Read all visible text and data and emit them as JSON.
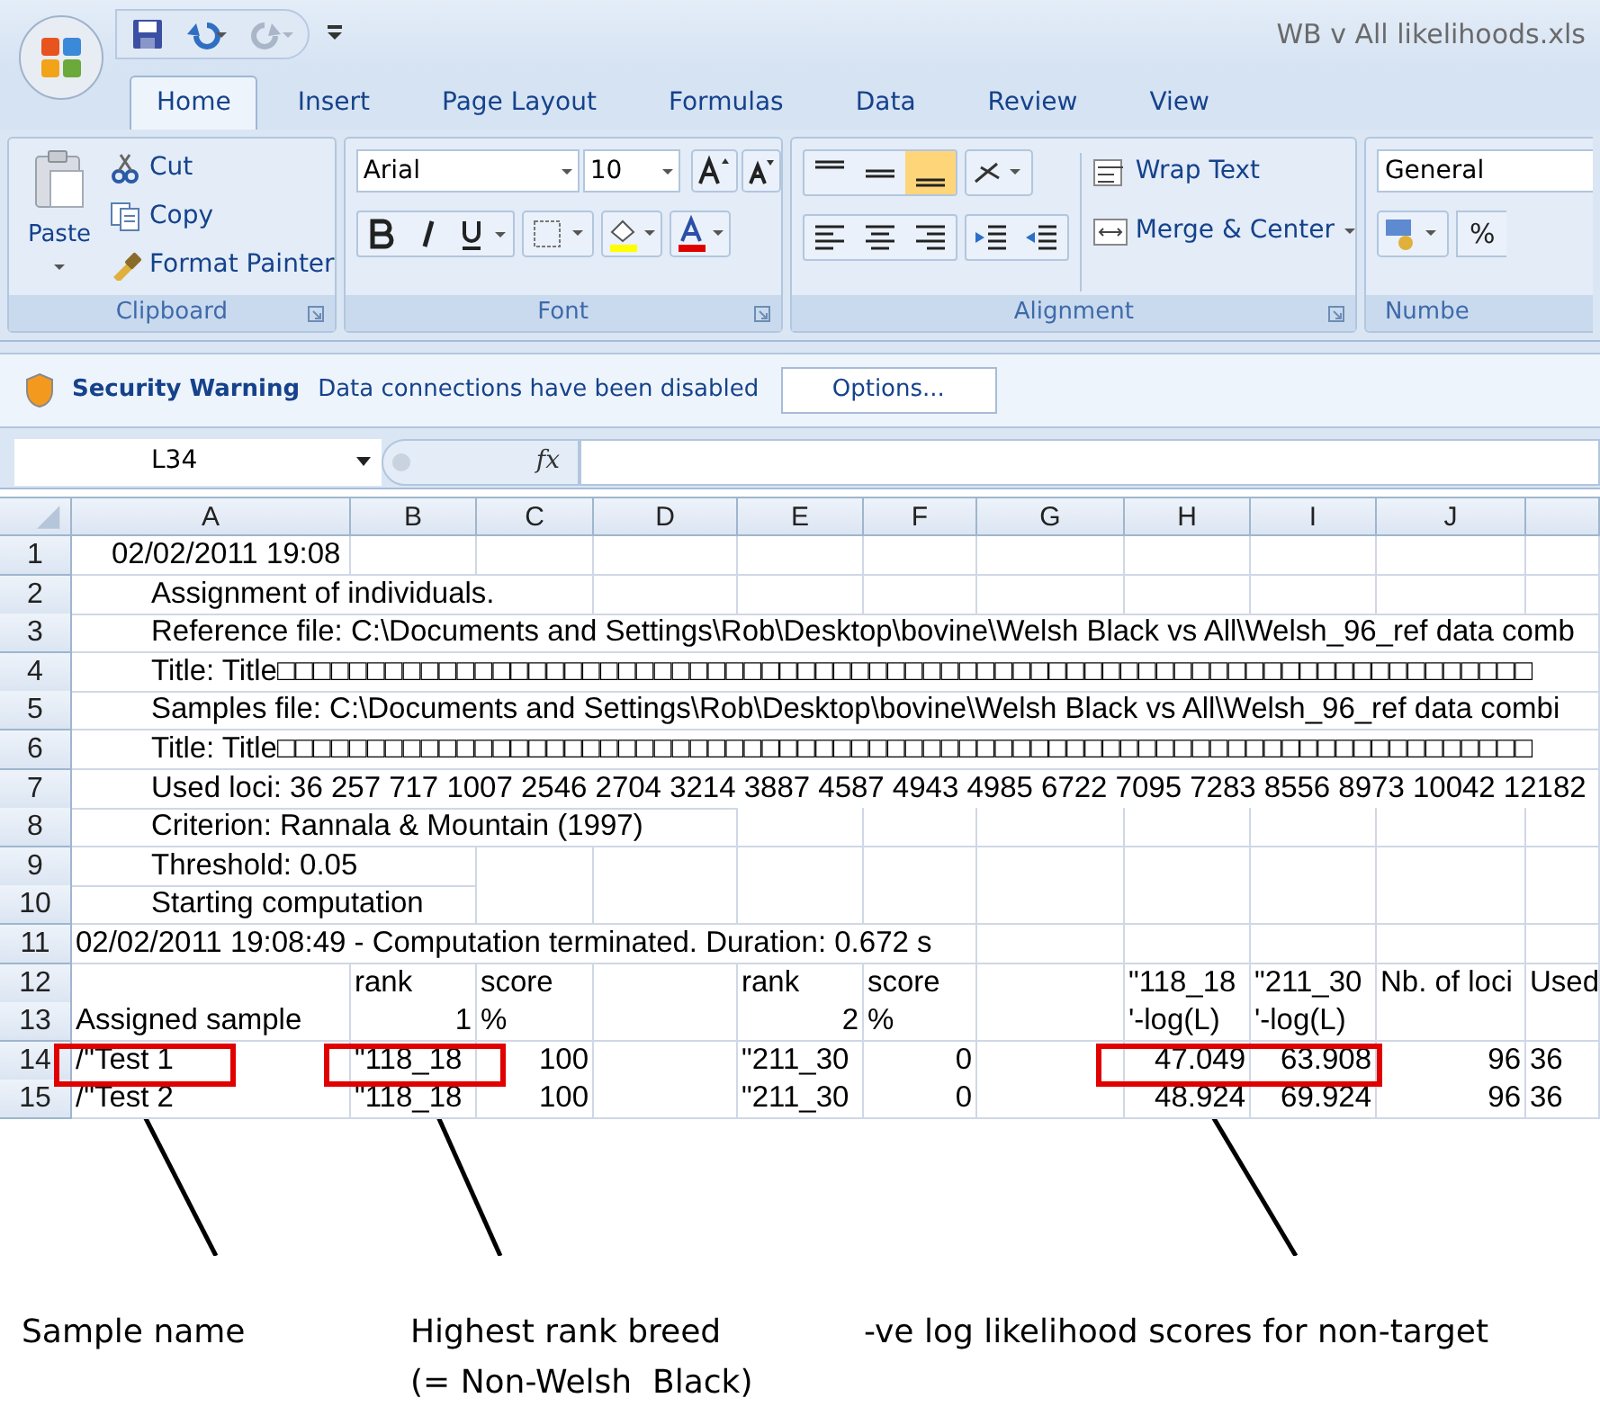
{
  "window": {
    "title": "WB v All likelihoods.xls"
  },
  "tabs": [
    {
      "label": "Home",
      "selected": true
    },
    {
      "label": "Insert",
      "selected": false
    },
    {
      "label": "Page Layout",
      "selected": false
    },
    {
      "label": "Formulas",
      "selected": false
    },
    {
      "label": "Data",
      "selected": false
    },
    {
      "label": "Review",
      "selected": false
    },
    {
      "label": "View",
      "selected": false
    }
  ],
  "ribbon": {
    "clipboard": {
      "label": "Clipboard",
      "paste": "Paste",
      "cut": "Cut",
      "copy": "Copy",
      "format_painter": "Format Painter"
    },
    "font": {
      "label": "Font",
      "font_name": "Arial",
      "font_size": "10"
    },
    "alignment": {
      "label": "Alignment",
      "vertical_align": [
        {
          "selected": false
        },
        {
          "selected": false
        },
        {
          "selected": true
        }
      ],
      "wrap_text": "Wrap Text",
      "merge_center": "Merge & Center"
    },
    "number": {
      "label": "Numbe",
      "format": "General",
      "percent": "%"
    }
  },
  "security_bar": {
    "title": "Security Warning",
    "message": "Data connections have been disabled",
    "button": "Options..."
  },
  "formula_bar": {
    "name_box": "L34",
    "fx": "fx"
  },
  "sheet": {
    "columns": [
      "A",
      "B",
      "C",
      "D",
      "E",
      "F",
      "G",
      "H",
      "I",
      "J"
    ],
    "rows": [
      {
        "number": "1",
        "note": "02/02/2011 19:08",
        "kind": "centered"
      },
      {
        "number": "2",
        "note": "Assignment of individuals."
      },
      {
        "number": "3",
        "note": "Reference file: C:\\Documents and Settings\\Rob\\Desktop\\bovine\\Welsh Black vs All\\Welsh_96_ref data comb"
      },
      {
        "number": "4",
        "note": "Title: Title□□□□□□□□□□□□□□□□□□□□□□□□□□□□□□□□□□□□□□□□□□□□□□□□□□□□□□□□□□□□□□□□□□□□□□"
      },
      {
        "number": "5",
        "note": "Samples file: C:\\Documents and Settings\\Rob\\Desktop\\bovine\\Welsh Black vs All\\Welsh_96_ref data combi"
      },
      {
        "number": "6",
        "note": "Title: Title□□□□□□□□□□□□□□□□□□□□□□□□□□□□□□□□□□□□□□□□□□□□□□□□□□□□□□□□□□□□□□□□□□□□□□"
      },
      {
        "number": "7",
        "note": "Used loci:  36 257 717 1007 2546 2704 3214 3887 4587 4943 4985 6722 7095 7283 8556 8973 10042 12182"
      },
      {
        "number": "8",
        "note": "Criterion: Rannala & Mountain (1997)"
      },
      {
        "number": "9",
        "note": "Threshold: 0.05"
      },
      {
        "number": "10",
        "note": "Starting computation"
      },
      {
        "number": "11",
        "note": "02/02/2011 19:08:49 - Computation terminated. Duration: 0.672 s",
        "kind": "flush"
      },
      {
        "number": "12",
        "cells": [
          null,
          "rank",
          "score",
          null,
          "rank",
          "score",
          null,
          "\"118_18",
          "\"211_30",
          "Nb. of loci",
          "Used"
        ]
      },
      {
        "number": "13",
        "cells": [
          "Assigned sample",
          {
            "text": "1",
            "kind": "number"
          },
          "%",
          null,
          {
            "text": "2",
            "kind": "number"
          },
          "%",
          null,
          "'-log(L)",
          "'-log(L)",
          null,
          null
        ]
      },
      {
        "number": "14",
        "cells": [
          "/\"Test 1",
          "\"118_18",
          {
            "text": "100",
            "kind": "number"
          },
          null,
          "\"211_30",
          {
            "text": "0",
            "kind": "number"
          },
          null,
          {
            "text": "47.049",
            "kind": "number"
          },
          {
            "text": "63.908",
            "kind": "number"
          },
          {
            "text": "96",
            "kind": "number"
          },
          "36"
        ]
      },
      {
        "number": "15",
        "cells": [
          "/\"Test 2",
          "\"118_18",
          {
            "text": "100",
            "kind": "number"
          },
          null,
          "\"211_30",
          {
            "text": "0",
            "kind": "number"
          },
          null,
          {
            "text": "48.924",
            "kind": "number"
          },
          {
            "text": "69.924",
            "kind": "number"
          },
          {
            "text": "96",
            "kind": "number"
          },
          "36"
        ]
      }
    ]
  },
  "annotations": [
    {
      "label": "Sample name"
    },
    {
      "label": "Highest rank breed\n(= Non-Welsh  Black)"
    },
    {
      "label": "-ve log likelihood scores for non-target"
    }
  ]
}
